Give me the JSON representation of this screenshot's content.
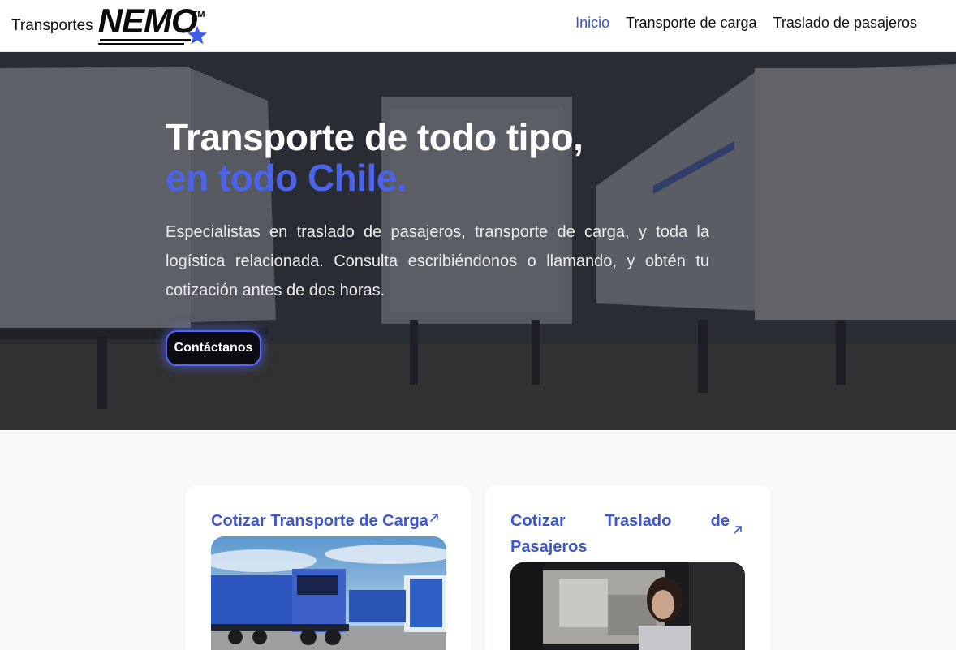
{
  "header": {
    "brand_text": "Transportes",
    "logo_word": "NEMO",
    "logo_tm": "TM",
    "nav": [
      {
        "label": "Inicio",
        "active": true
      },
      {
        "label": "Transporte de carga",
        "active": false
      },
      {
        "label": "Traslado de pasajeros",
        "active": false
      }
    ]
  },
  "hero": {
    "title_line1": "Transporte de todo tipo,",
    "title_line2": "en todo Chile.",
    "description": "Especialistas en traslado de pasajeros, transporte de carga, y toda la logística relacionada. Consulta escribiéndonos o llamando, y obtén tu cotización antes de dos horas.",
    "button_label": "Contáctanos"
  },
  "cards": [
    {
      "title": "Cotizar Transporte de Carga",
      "icon": "arrow-up-right-icon",
      "image": "blue-truck-photo"
    },
    {
      "title": "Cotizar Traslado de Pasajeros",
      "icon": "arrow-up-right-icon",
      "image": "passenger-in-car-photo"
    }
  ],
  "colors": {
    "accent": "#3d57c9",
    "hero_accent": "#4a63e8",
    "button_glow": "#5367ff",
    "page_bg": "#f8f9fb"
  }
}
